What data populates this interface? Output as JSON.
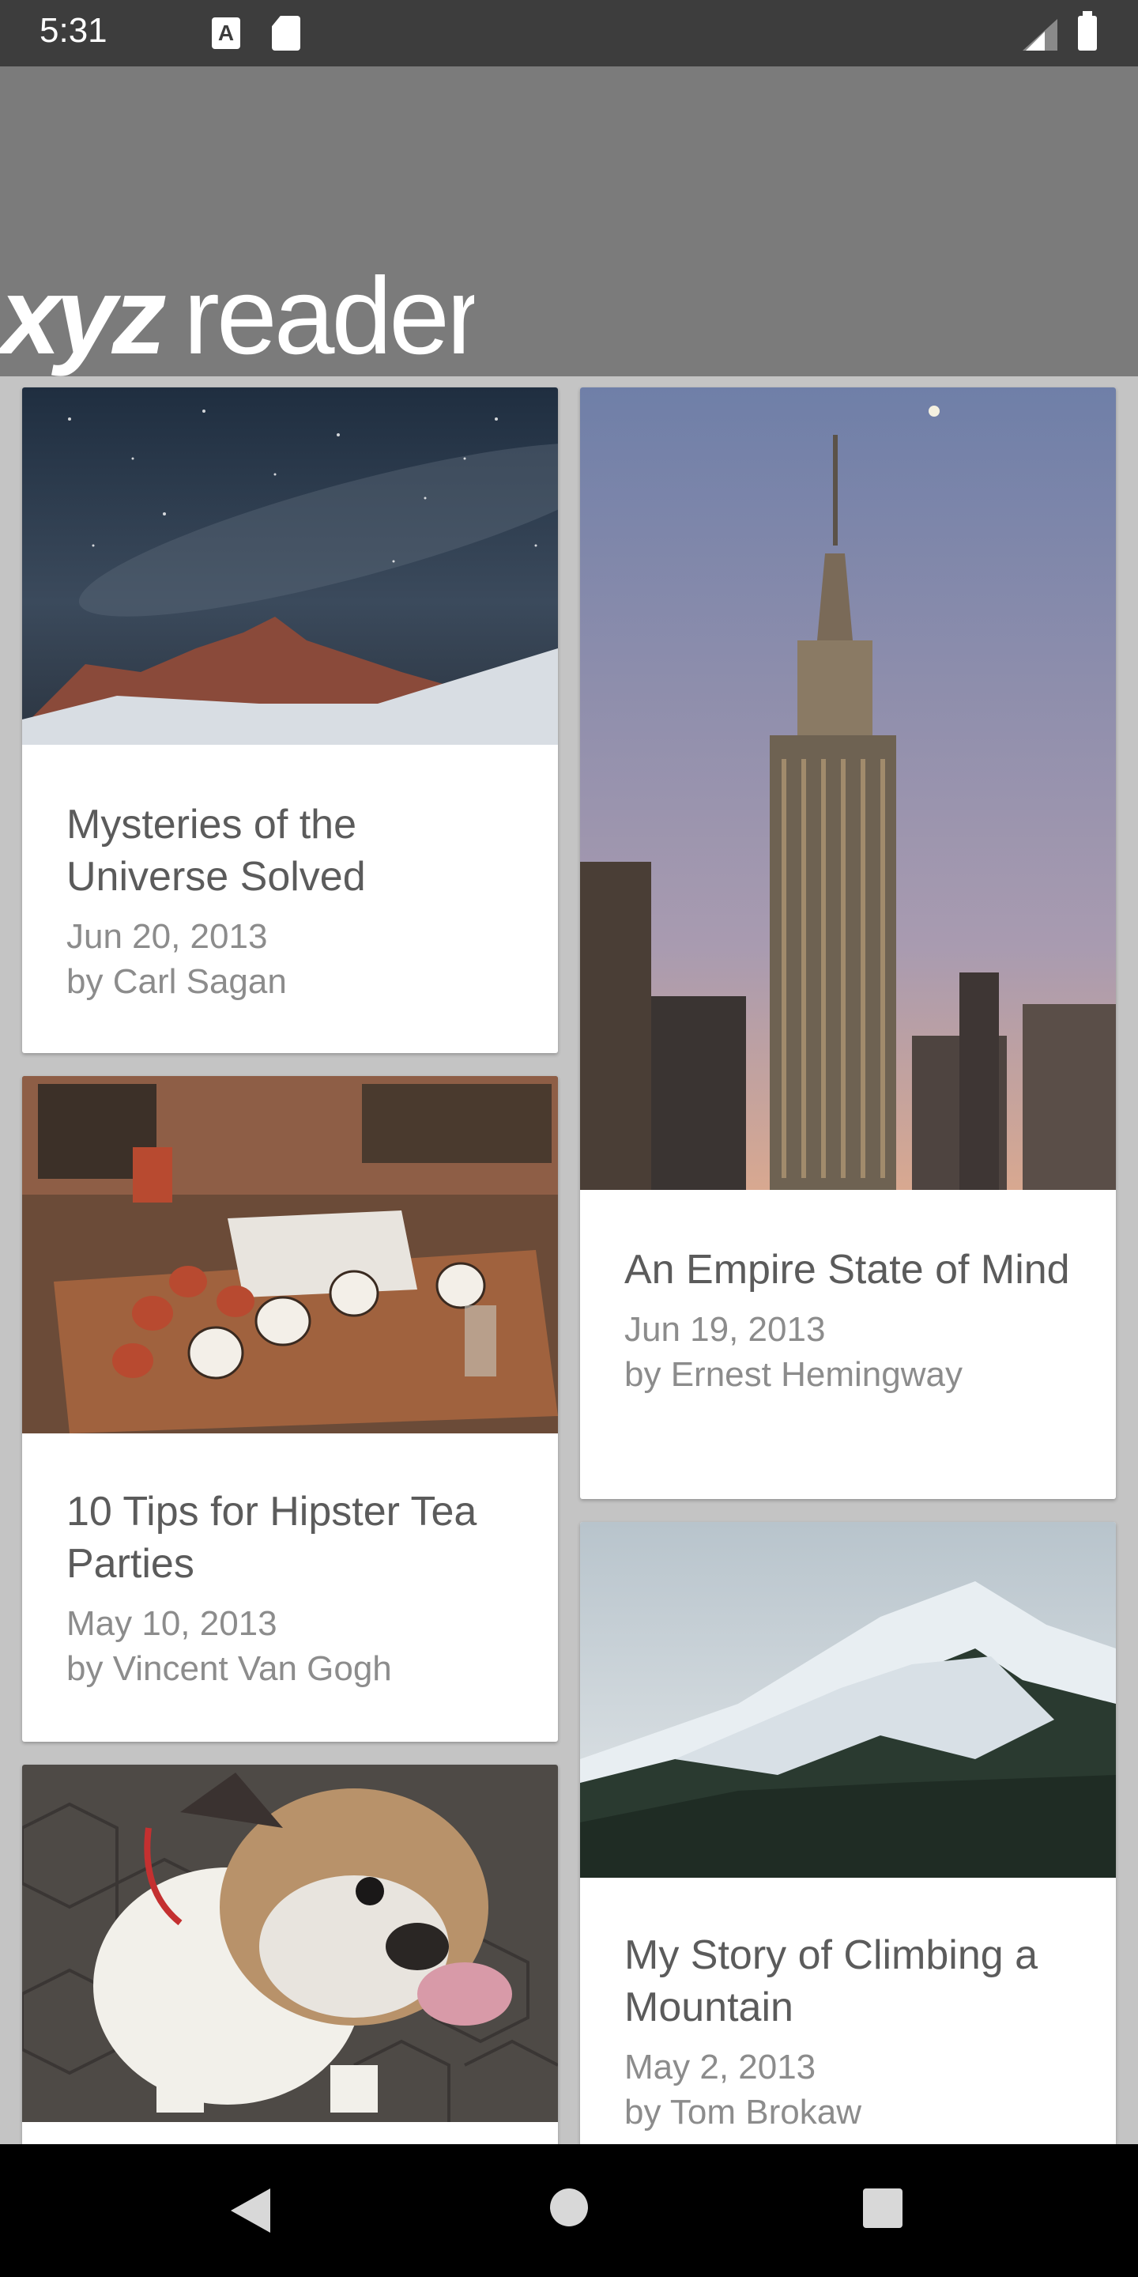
{
  "status_bar": {
    "time": "5:31",
    "icons": [
      "a-icon",
      "sd-card-icon",
      "signal-icon",
      "battery-icon"
    ]
  },
  "app_bar": {
    "logo_bold": "xyz",
    "logo_light": "reader",
    "background": "#7b7b7b"
  },
  "articles": [
    {
      "title": "Mysteries of the Universe Solved",
      "date": "Jun 20, 2013",
      "author": "by Carl Sagan",
      "image": "night-sky-mountain"
    },
    {
      "title": "An Empire State of Mind",
      "date": "Jun 19, 2013",
      "author": "by Ernest Hemingway",
      "image": "empire-state-building"
    },
    {
      "title": "10 Tips for Hipster Tea Parties",
      "date": "May 10, 2013",
      "author": "by Vincent Van Gogh",
      "image": "tea-cups-table"
    },
    {
      "title": "My Story of Climbing a Mountain",
      "date": "May 2, 2013",
      "author": "by Tom Brokaw",
      "image": "snowy-mountain"
    },
    {
      "title": "",
      "date": "",
      "author": "",
      "image": "bulldog"
    }
  ],
  "nav_bar": {
    "icons": [
      "back-icon",
      "home-icon",
      "recents-icon"
    ]
  }
}
